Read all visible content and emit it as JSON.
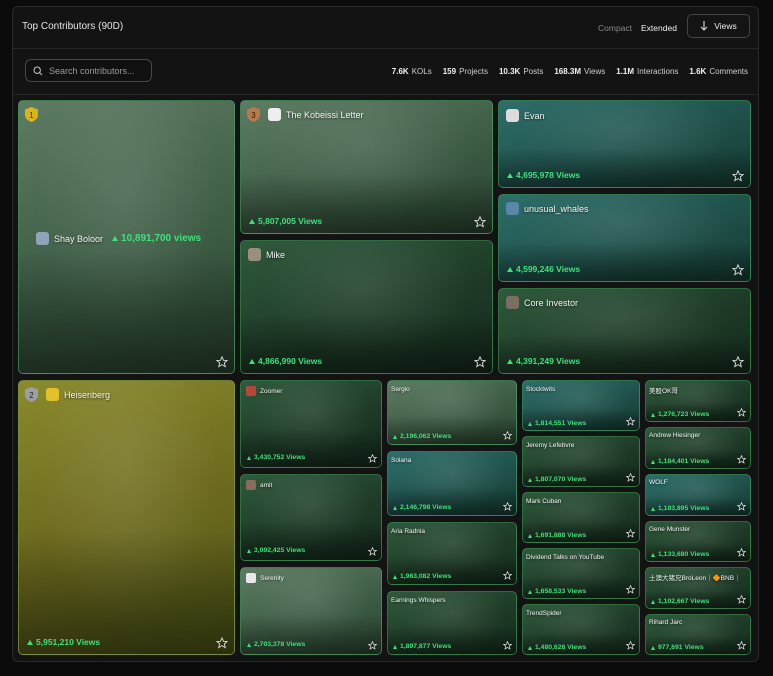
{
  "header": {
    "title": "Top Contributors (90D)",
    "mode_compact": "Compact",
    "mode_extended": "Extended",
    "views_button": "Views"
  },
  "search": {
    "placeholder": "Search contributors..."
  },
  "stats": [
    {
      "value": "7.6K",
      "label": "KOLs"
    },
    {
      "value": "159",
      "label": "Projects"
    },
    {
      "value": "10.3K",
      "label": "Posts"
    },
    {
      "value": "168.3M",
      "label": "Views"
    },
    {
      "value": "1.1M",
      "label": "Interactions"
    },
    {
      "value": "1.6K",
      "label": "Comments"
    }
  ],
  "ranks": [
    "1",
    "2",
    "3"
  ],
  "contributors": [
    {
      "name": "Shay Boloor",
      "views": "10,891,700 views"
    },
    {
      "name": "The Kobeissi Letter",
      "views": "5,807,005 Views"
    },
    {
      "name": "Mike",
      "views": "4,866,990 Views"
    },
    {
      "name": "Evan",
      "views": "4,695,978 Views"
    },
    {
      "name": "unusual_whales",
      "views": "4,599,246 Views"
    },
    {
      "name": "Core Investor",
      "views": "4,391,249 Views"
    },
    {
      "name": "Heisenberg",
      "views": "5,951,210 Views"
    },
    {
      "name": "Zoomer",
      "views": "3,430,752 Views"
    },
    {
      "name": "amit",
      "views": "3,092,425 Views"
    },
    {
      "name": "Serenity",
      "views": "2,703,378 Views"
    },
    {
      "name": "Sergio",
      "views": "2,196,062 Views"
    },
    {
      "name": "Solana",
      "views": "2,146,798 Views"
    },
    {
      "name": "Aria Radnia",
      "views": "1,963,082 Views"
    },
    {
      "name": "Earnings Whispers",
      "views": "1,897,877 Views"
    },
    {
      "name": "Stocktwits",
      "views": "1,814,551 Views"
    },
    {
      "name": "Jeremy Lefebvre",
      "views": "1,807,070 Views"
    },
    {
      "name": "Mark Cuban",
      "views": "1,691,888 Views"
    },
    {
      "name": "Dividend Talks on YouTube",
      "views": "1,658,533 Views"
    },
    {
      "name": "TrendSpider",
      "views": "1,480,628 Views"
    },
    {
      "name": "美股OK哥",
      "views": "1,276,723 Views"
    },
    {
      "name": "Andrew Hiesinger",
      "views": "1,184,401 Views"
    },
    {
      "name": "WOLF",
      "views": "1,183,895 Views"
    },
    {
      "name": "Gene Munster",
      "views": "1,133,680 Views"
    },
    {
      "name": "土澳大猪兄BroLeon｜🔶BNB｜",
      "views": "1,102,667 Views"
    },
    {
      "name": "Rihard Jarc",
      "views": "977,691 Views"
    }
  ],
  "colors": {
    "accent_green": "#3ee07a",
    "gold_badge": "#d9b51c",
    "silver_badge": "#9aa0a6",
    "bronze_badge": "#b87a4b"
  }
}
